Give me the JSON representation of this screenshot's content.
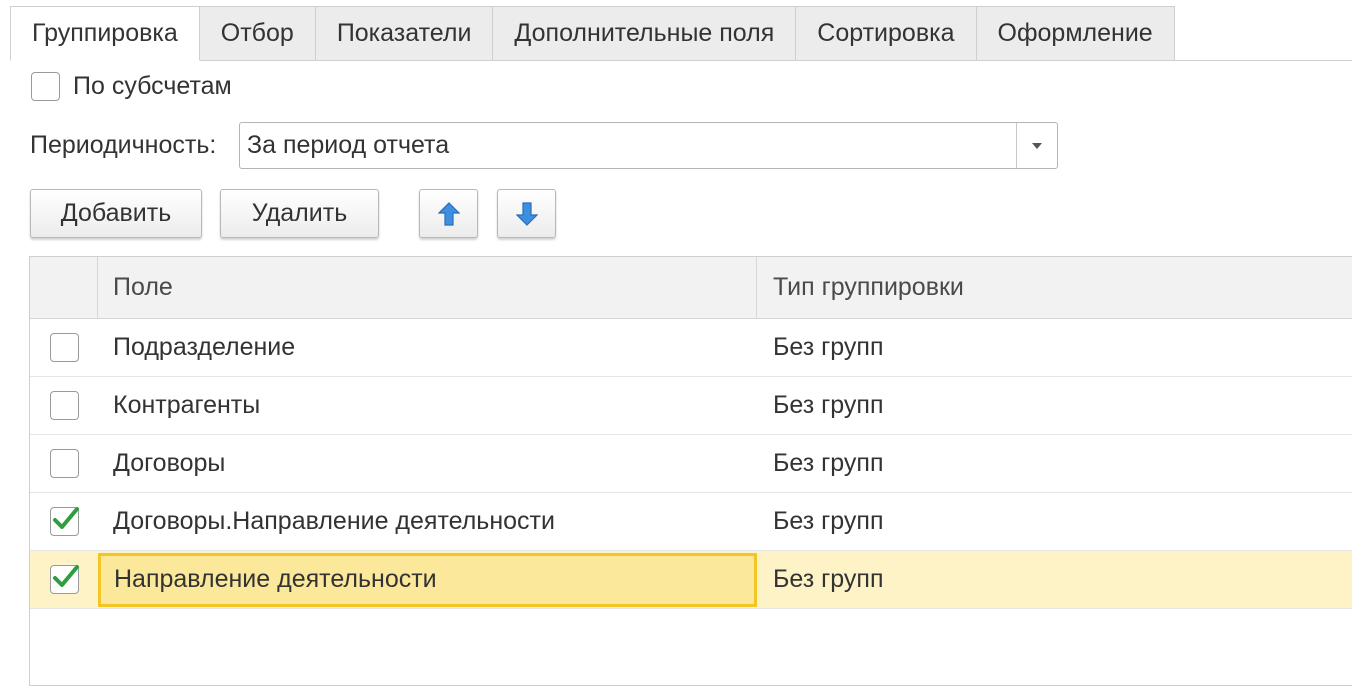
{
  "tabs": [
    {
      "label": "Группировка",
      "active": true
    },
    {
      "label": "Отбор",
      "active": false
    },
    {
      "label": "Показатели",
      "active": false
    },
    {
      "label": "Дополнительные поля",
      "active": false
    },
    {
      "label": "Сортировка",
      "active": false
    },
    {
      "label": "Оформление",
      "active": false
    }
  ],
  "subaccounts": {
    "label": "По субсчетам",
    "checked": false
  },
  "period": {
    "label": "Периодичность:",
    "value": "За период отчета"
  },
  "buttons": {
    "add": "Добавить",
    "delete": "Удалить",
    "move_up_icon": "arrow-up-icon",
    "move_down_icon": "arrow-down-icon"
  },
  "table": {
    "headers": {
      "field": "Поле",
      "type": "Тип группировки"
    },
    "rows": [
      {
        "field": "Подразделение",
        "type": "Без групп",
        "checked": false,
        "selected": false
      },
      {
        "field": "Контрагенты",
        "type": "Без групп",
        "checked": false,
        "selected": false
      },
      {
        "field": "Договоры",
        "type": "Без групп",
        "checked": false,
        "selected": false
      },
      {
        "field": "Договоры.Направление деятельности",
        "type": "Без групп",
        "checked": true,
        "selected": false
      },
      {
        "field": "Направление деятельности",
        "type": "Без групп",
        "checked": true,
        "selected": true
      }
    ]
  },
  "colors": {
    "check": "#2e9e3e",
    "arrow": "#3d8fe0",
    "selected_row": "#fdf3c7",
    "selected_cell_border": "#f3c623"
  }
}
